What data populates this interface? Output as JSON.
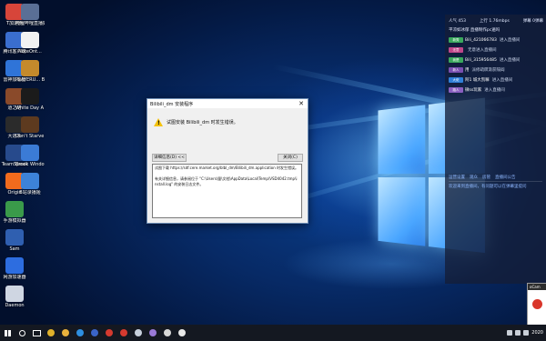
{
  "desktop": {
    "icons_col1": [
      {
        "label": "T加速器",
        "icon": "app-icon",
        "color": "#d7453a"
      },
      {
        "label": "腾讯客户端",
        "icon": "app-icon",
        "color": "#3a6ecf"
      },
      {
        "label": "雷神加速器",
        "icon": "app-icon",
        "color": "#2f74d8"
      },
      {
        "label": "道之塔",
        "icon": "game-icon",
        "color": "#8a4a2a"
      },
      {
        "label": "大逃杀",
        "icon": "game-icon",
        "color": "#2b2b2b"
      },
      {
        "label": "TeamSpeak",
        "icon": "app-icon",
        "color": "#274a8c"
      },
      {
        "label": "Origin",
        "icon": "app-icon",
        "color": "#f26b1d"
      },
      {
        "label": "手游模拟器",
        "icon": "app-icon",
        "color": "#3a9a4a"
      },
      {
        "label": "Sam",
        "icon": "app-icon",
        "color": "#2f5fb0"
      },
      {
        "label": "网游加速器",
        "icon": "app-icon",
        "color": "#2d6de0"
      },
      {
        "label": "Daemon",
        "icon": "app-icon",
        "color": "#cfd6e2"
      }
    ],
    "icons_col2": [
      {
        "label": "哔哩哔哩直播姬",
        "icon": "app-icon",
        "color": "#5a6f96"
      },
      {
        "label": "NoteOnt...",
        "icon": "app-icon",
        "color": "#f2f2f2"
      },
      {
        "label": "PLAYERU... BATTLEGR...",
        "icon": "game-icon",
        "color": "#c48a2c"
      },
      {
        "label": "White Day A Labyrinth ...",
        "icon": "game-icon",
        "color": "#1b1b1b"
      },
      {
        "label": "Don't Starve Together",
        "icon": "game-icon",
        "color": "#5d3a1f"
      },
      {
        "label": "Brook Windows...",
        "icon": "app-icon",
        "color": "#3b7bd6"
      },
      {
        "label": "B站录播姬",
        "icon": "app-icon",
        "color": "#3d82d8"
      }
    ]
  },
  "dialog": {
    "title": "Bilibili_dm 安装程序",
    "close_glyph": "✕",
    "warning_glyph": "!",
    "message": "试图安装 Bilibili_dm 时发生错误。",
    "details_button": "详细信息(D) <<",
    "close_button": "关闭(C)",
    "details_lines": [
      "试图下载 https://sdf.cere.market.org/blbl_dm/Bilibili_dm.application 时发生错误。",
      "",
      "有关详细信息，请参阅位于 \"C:\\Users\\量\\文档\\AppData\\Local\\Temp\\VSD4042.tmp\\install.log\" 的安装日志文件。"
    ]
  },
  "chat": {
    "popularity": "人气 453",
    "speed": "上行 1.76mbps",
    "status": "弹幕 0弹幕",
    "pinned": "平凉如冰郁 直播制作pc遍吗",
    "messages": [
      {
        "badge": "新秀",
        "badge_color": "#3aa85c",
        "nick": "Bili_421066783",
        "action": "进入直播间"
      },
      {
        "badge": "无意",
        "badge_color": "#c0468a",
        "nick": "",
        "action": "无意进入直播间"
      },
      {
        "badge": "我是",
        "badge_color": "#3aa85c",
        "nick": "Bili_315956485",
        "action": "进入直播间"
      },
      {
        "badge": "新人",
        "badge_color": "#7a4fb0",
        "nick": "用",
        "action": "派修疏瞑渐获隔阎"
      },
      {
        "badge": "大佬",
        "badge_color": "#2f7fd8",
        "nick": "阿1 城大凯嘛",
        "action": "进入直播间"
      },
      {
        "badge": "路人",
        "badge_color": "#8a5fc0",
        "nick": "微ss玩家",
        "action": "进入直播间"
      }
    ],
    "tabs": [
      "运营设置",
      "观众",
      "房管",
      "直播间公告"
    ],
    "notice": "欢迎来到直播间，有问题可以在弹幕里提问"
  },
  "notification": {
    "title": "oCam"
  },
  "taskbar": {
    "apps": [
      {
        "icon": "start-icon",
        "color": "#ffffff"
      },
      {
        "icon": "search-icon",
        "color": "#ffffff"
      },
      {
        "icon": "task-view-icon",
        "color": "#ffffff"
      },
      {
        "icon": "chrome-icon",
        "color": "#e0b12a"
      },
      {
        "icon": "folder-icon",
        "color": "#e8b13c"
      },
      {
        "icon": "app-icon",
        "color": "#2e8fe0"
      },
      {
        "icon": "app-icon",
        "color": "#3a64c8"
      },
      {
        "icon": "netease-music-icon",
        "color": "#d63a2f"
      },
      {
        "icon": "app-icon",
        "color": "#d63a2f"
      },
      {
        "icon": "steam-icon",
        "color": "#c7d0dc"
      },
      {
        "icon": "app-icon",
        "color": "#9a7ad8"
      },
      {
        "icon": "game-icon",
        "color": "#d8d8d8"
      },
      {
        "icon": "settings-icon",
        "color": "#e8e8e8"
      }
    ],
    "clock": "2020"
  }
}
